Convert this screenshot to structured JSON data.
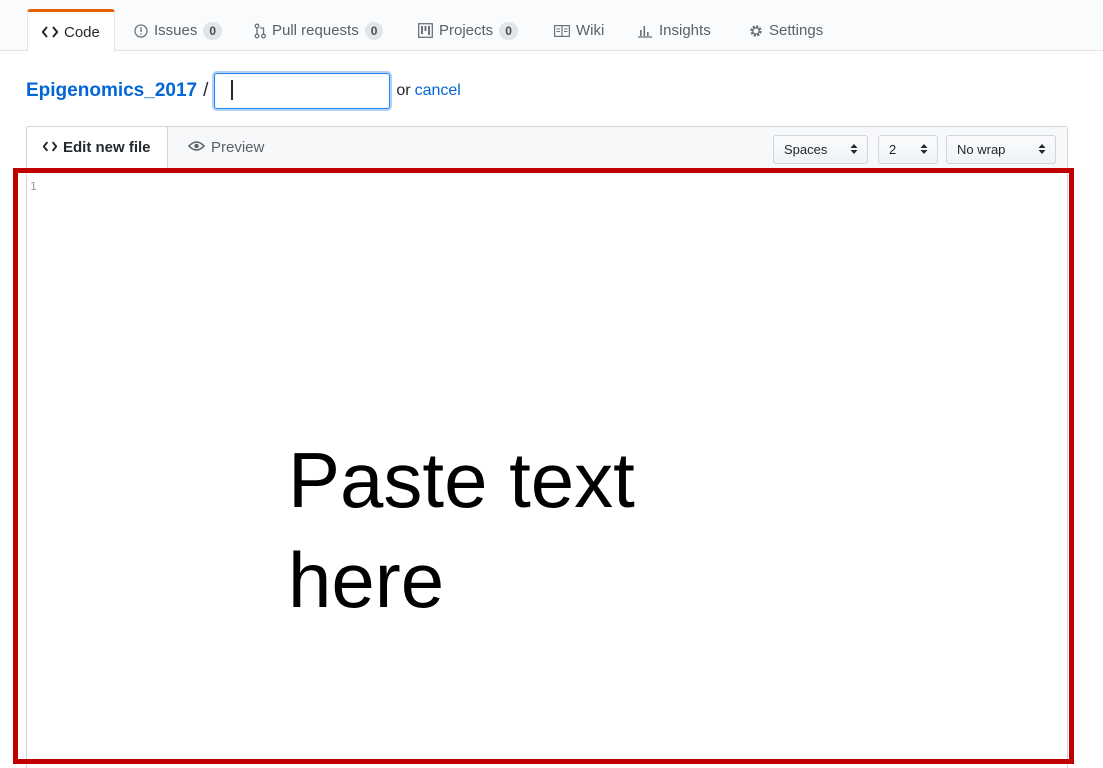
{
  "tabs": [
    {
      "label": "Code",
      "icon": "code-icon",
      "selected": true
    },
    {
      "label": "Issues",
      "icon": "issue-icon",
      "count": "0"
    },
    {
      "label": "Pull requests",
      "icon": "pull-request-icon",
      "count": "0"
    },
    {
      "label": "Projects",
      "icon": "project-icon",
      "count": "0"
    },
    {
      "label": "Wiki",
      "icon": "book-icon"
    },
    {
      "label": "Insights",
      "icon": "graph-icon"
    },
    {
      "label": "Settings",
      "icon": "gear-icon"
    }
  ],
  "breadcrumb": {
    "repo": "Epigenomics_2017",
    "separator": "/",
    "filename_value": "",
    "or_text": "or",
    "cancel": "cancel"
  },
  "editor": {
    "tabs": [
      {
        "label": "Edit new file",
        "icon": "code-icon",
        "selected": true
      },
      {
        "label": "Preview",
        "icon": "eye-icon"
      }
    ],
    "indent_mode": "Spaces",
    "indent_size": "2",
    "wrap_mode": "No wrap",
    "line_number": "1"
  },
  "annotation": {
    "text_line1": "Paste text",
    "text_line2": "here",
    "color": "#c00000"
  },
  "colors": {
    "link": "#0366d6",
    "tab_accent": "#e36209"
  }
}
